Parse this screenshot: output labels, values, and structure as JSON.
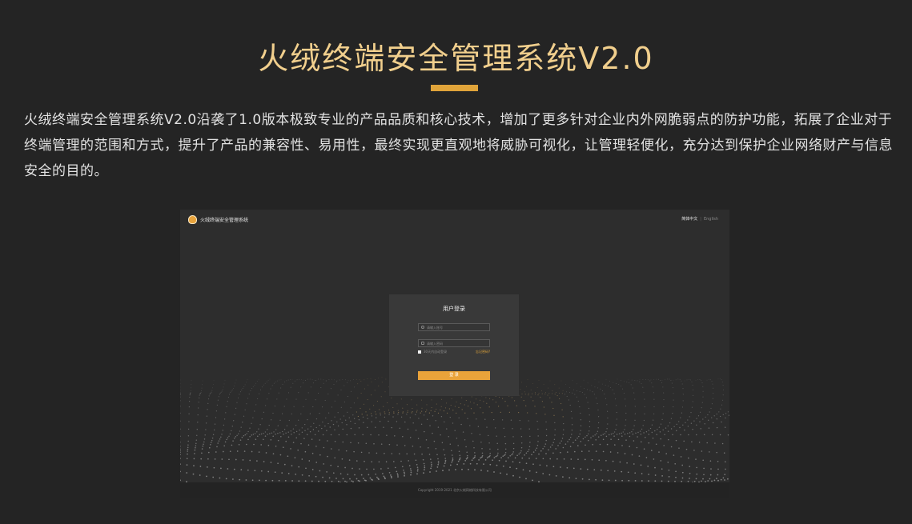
{
  "page": {
    "title": "火绒终端安全管理系统V2.0",
    "description": "火绒终端安全管理系统V2.0沿袭了1.0版本极致专业的产品品质和核心技术，增加了更多针对企业内外网脆弱点的防护功能，拓展了企业对于终端管理的范围和方式，提升了产品的兼容性、易用性，最终实现更直观地将威胁可视化，让管理轻便化，充分达到保护企业网络财产与信息安全的目的。"
  },
  "colors": {
    "accent": "#e0a43a",
    "title": "#f1cf8d",
    "background": "#242424"
  },
  "screenshot": {
    "app_name": "火绒终端安全管理系统",
    "logo_icon": "huorong-logo-icon",
    "lang_active": "简体中文",
    "lang_separator": "|",
    "lang_other": "English",
    "login": {
      "title": "用户登录",
      "username_placeholder": "请输入账号",
      "password_placeholder": "请输入密码",
      "remember_label": "30天内自动登录",
      "forgot_link": "忘记密码?",
      "submit_label": "登 录"
    },
    "footer": "Copyright 2019-2021 北京火绒网络科技有限公司"
  }
}
